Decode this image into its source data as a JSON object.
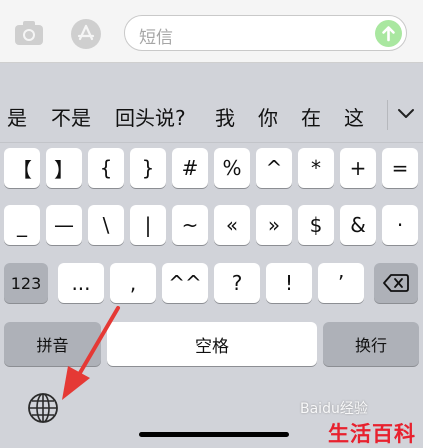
{
  "compose": {
    "placeholder": "短信"
  },
  "suggestions": [
    "是",
    "不是",
    "回头说?",
    "我",
    "你",
    "在",
    "这"
  ],
  "keys": {
    "row1": [
      "【",
      "】",
      "{",
      "}",
      "#",
      "%",
      "^",
      "*",
      "+",
      "="
    ],
    "row2": [
      "_",
      "—",
      "\\",
      "|",
      "~",
      "«",
      "»",
      "$",
      "&",
      "·"
    ],
    "row3_left": "123",
    "row3": [
      "...",
      ",",
      "^^",
      "?",
      "!",
      "’"
    ],
    "row4": {
      "pinyin": "拼音",
      "space": "空格",
      "return": "换行"
    }
  },
  "watermark": "Baidu经验",
  "brand": "生活百科",
  "colors": {
    "arrow": "#e53935",
    "brand": "#e8212e",
    "send": "#a9e7a0"
  }
}
